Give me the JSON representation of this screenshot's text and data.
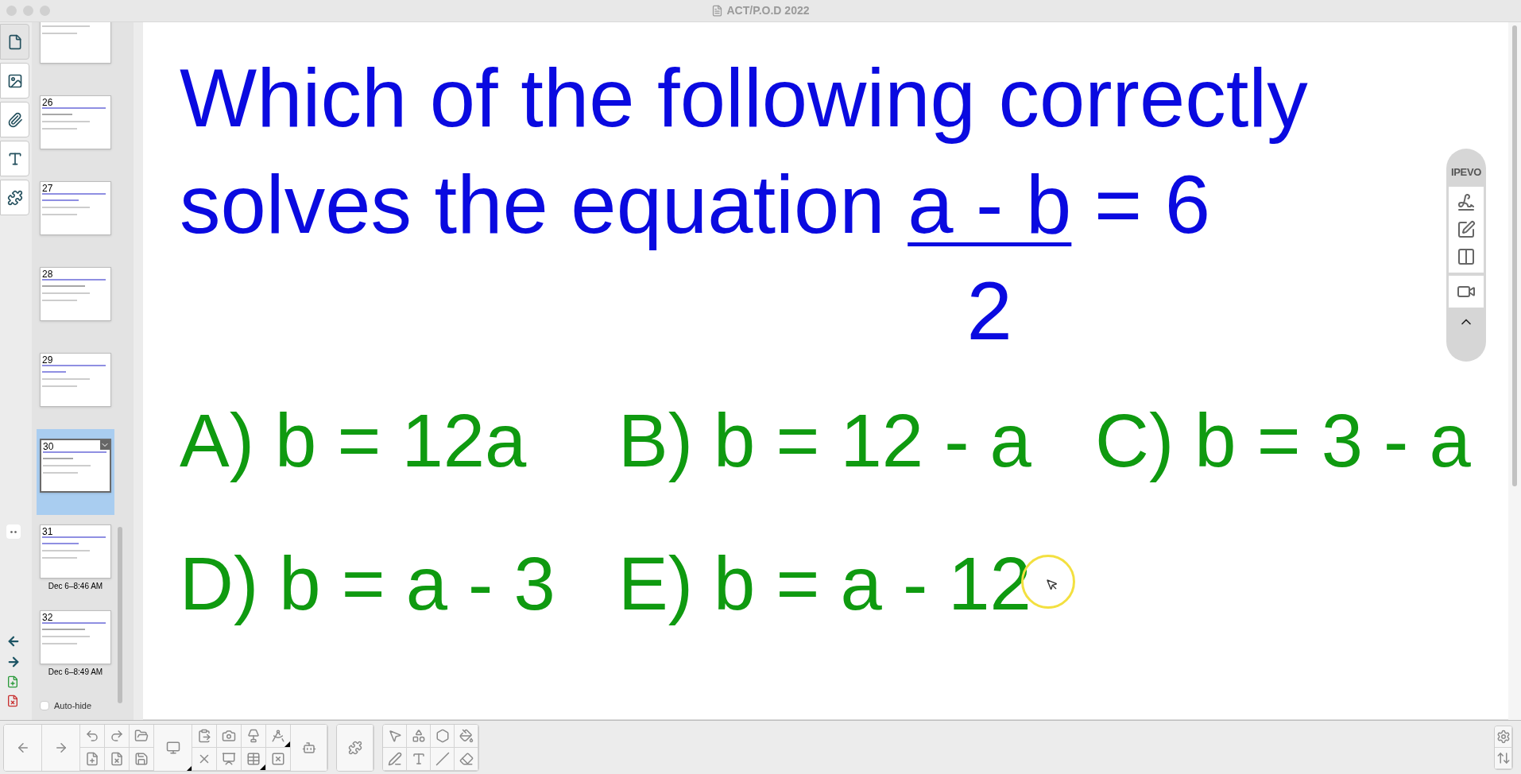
{
  "window": {
    "title": "ACT/P.O.D 2022"
  },
  "slide_panel": {
    "slides": [
      {
        "selected": false
      },
      {
        "number": "26",
        "selected": false
      },
      {
        "number": "27",
        "selected": false
      },
      {
        "number": "28",
        "selected": false
      },
      {
        "number": "29",
        "selected": false
      },
      {
        "number": "30",
        "selected": true
      },
      {
        "number": "31",
        "selected": false,
        "time": "Dec 6–8:46 AM"
      },
      {
        "number": "32",
        "selected": false,
        "time": "Dec 6–8:49 AM"
      }
    ],
    "auto_hide": {
      "label": "Auto-hide",
      "checked": false
    }
  },
  "slide": {
    "question": [
      "Which of the following correctly",
      "solves the equation"
    ],
    "fraction": {
      "numerator": "a - b",
      "denominator": "2"
    },
    "equals": "= 6",
    "answer_rows": [
      [
        "A) b = 12a",
        "B) b = 12 - a",
        "C) b = 3 - a"
      ],
      [
        "D) b = a - 3",
        "E) b = a - 12"
      ]
    ]
  },
  "ipevo_toolbar": {
    "logo": "IPEVO"
  }
}
